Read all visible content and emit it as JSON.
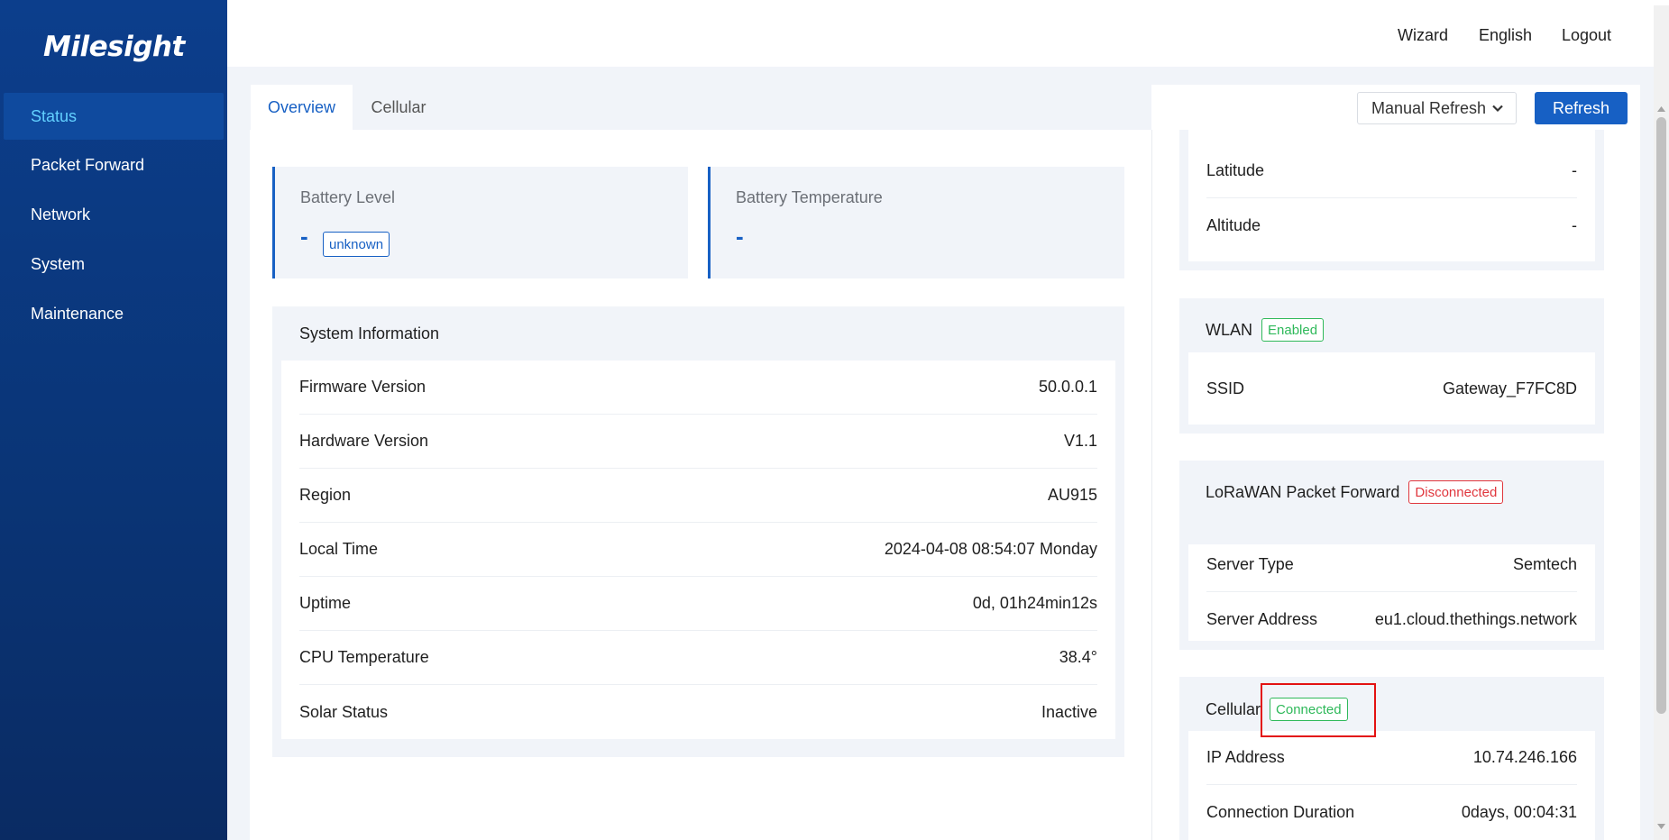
{
  "brand": {
    "logo": "Milesight"
  },
  "sidebar": {
    "items": [
      {
        "label": "Status",
        "active": true
      },
      {
        "label": "Packet Forward"
      },
      {
        "label": "Network"
      },
      {
        "label": "System"
      },
      {
        "label": "Maintenance"
      }
    ]
  },
  "header": {
    "wizard": "Wizard",
    "language": "English",
    "logout": "Logout"
  },
  "tabs": [
    {
      "label": "Overview",
      "active": true
    },
    {
      "label": "Cellular"
    }
  ],
  "toolbar": {
    "refresh_mode": "Manual Refresh",
    "refresh_button": "Refresh"
  },
  "battery": {
    "level_label": "Battery Level",
    "level_value": "-",
    "level_badge": "unknown",
    "temp_label": "Battery Temperature",
    "temp_value": "-"
  },
  "system_info": {
    "title": "System Information",
    "rows": [
      {
        "label": "Firmware Version",
        "value": "50.0.0.1"
      },
      {
        "label": "Hardware Version",
        "value": "V1.1"
      },
      {
        "label": "Region",
        "value": "AU915"
      },
      {
        "label": "Local Time",
        "value": "2024-04-08 08:54:07 Monday"
      },
      {
        "label": "Uptime",
        "value": "0d, 01h24min12s"
      },
      {
        "label": "CPU Temperature",
        "value": "38.4°"
      },
      {
        "label": "Solar Status",
        "value": "Inactive"
      }
    ]
  },
  "location": {
    "rows": [
      {
        "label": "Latitude",
        "value": "-"
      },
      {
        "label": "Altitude",
        "value": "-"
      }
    ]
  },
  "wlan": {
    "title": "WLAN",
    "badge": "Enabled",
    "rows": [
      {
        "label": "SSID",
        "value": "Gateway_F7FC8D"
      }
    ]
  },
  "lorawan": {
    "title": "LoRaWAN Packet Forward",
    "badge": "Disconnected",
    "rows": [
      {
        "label": "Server Type",
        "value": "Semtech"
      },
      {
        "label": "Server Address",
        "value": "eu1.cloud.thethings.network"
      }
    ]
  },
  "cellular": {
    "title": "Cellular",
    "badge": "Connected",
    "rows": [
      {
        "label": "IP Address",
        "value": "10.74.246.166"
      },
      {
        "label": "Connection Duration",
        "value": "0days, 00:04:31"
      }
    ]
  },
  "colors": {
    "sidebar": "#0c3e8c",
    "accent": "#1760c4",
    "active_nav_text": "#62d0ff",
    "success": "#2fb95a",
    "danger": "#e0363d"
  }
}
